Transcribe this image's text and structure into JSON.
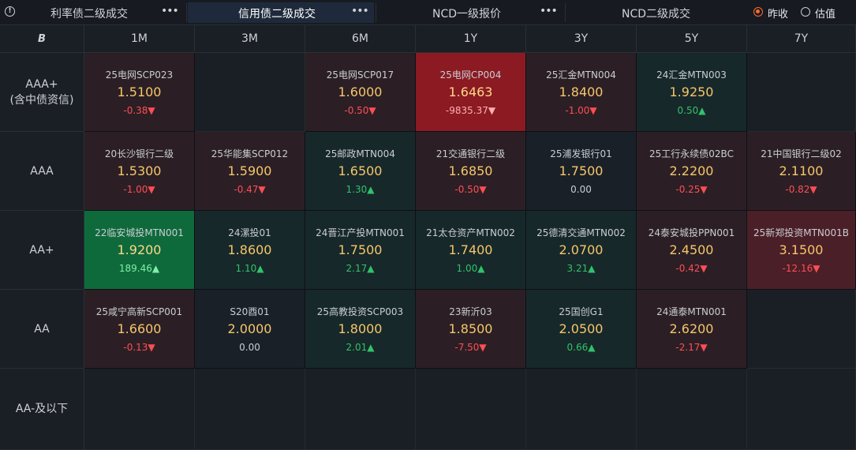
{
  "tabs": [
    {
      "label": "利率债二级成交",
      "more": "•••",
      "active": false
    },
    {
      "label": "信用债二级成交",
      "more": "•••",
      "active": true
    },
    {
      "label": "NCD一级报价",
      "more": "•••",
      "active": false
    },
    {
      "label": "NCD二级成交",
      "more": "",
      "active": false
    }
  ],
  "info_icon": "!",
  "price_mode": [
    {
      "label": "昨收",
      "selected": true
    },
    {
      "label": "估值",
      "selected": false
    }
  ],
  "corner_icon": "B",
  "columns": [
    "1M",
    "3M",
    "6M",
    "1Y",
    "3Y",
    "5Y",
    "7Y"
  ],
  "rows": [
    {
      "label": "AAA+\n(含中债资信)",
      "cells": [
        {
          "name": "25电网SCP023",
          "value": "1.5100",
          "change": "-0.38▼",
          "dir": "down",
          "bg": "bg-red"
        },
        null,
        {
          "name": "25电网SCP017",
          "value": "1.6000",
          "change": "-0.50▼",
          "dir": "down",
          "bg": "bg-red"
        },
        {
          "name": "25电网CP004",
          "value": "1.6463",
          "change": "-9835.37▼",
          "dir": "down",
          "bg": "bg-red-strong"
        },
        {
          "name": "25汇金MTN004",
          "value": "1.8400",
          "change": "-1.00▼",
          "dir": "down",
          "bg": "bg-red"
        },
        {
          "name": "24汇金MTN003",
          "value": "1.9250",
          "change": "0.50▲",
          "dir": "up",
          "bg": "bg-green"
        },
        null
      ]
    },
    {
      "label": "AAA",
      "cells": [
        {
          "name": "20长沙银行二级",
          "value": "1.5300",
          "change": "-1.00▼",
          "dir": "down",
          "bg": "bg-red"
        },
        {
          "name": "25华能集SCP012",
          "value": "1.5900",
          "change": "-0.47▼",
          "dir": "down",
          "bg": "bg-red"
        },
        {
          "name": "25邮政MTN004",
          "value": "1.6500",
          "change": "1.30▲",
          "dir": "up",
          "bg": "bg-green"
        },
        {
          "name": "21交通银行二级",
          "value": "1.6850",
          "change": "-0.50▼",
          "dir": "down",
          "bg": "bg-red"
        },
        {
          "name": "25浦发银行01",
          "value": "1.7500",
          "change": "0.00",
          "dir": "flat",
          "bg": "bg-neutral"
        },
        {
          "name": "25工行永续债02BC",
          "value": "2.2200",
          "change": "-0.25▼",
          "dir": "down",
          "bg": "bg-red"
        },
        {
          "name": "21中国银行二级02",
          "value": "2.1100",
          "change": "-0.82▼",
          "dir": "down",
          "bg": "bg-red"
        }
      ]
    },
    {
      "label": "AA+",
      "cells": [
        {
          "name": "22临安城投MTN001",
          "value": "1.9200",
          "change": "189.46▲",
          "dir": "up",
          "bg": "bg-green-strong"
        },
        {
          "name": "24漯投01",
          "value": "1.8600",
          "change": "1.10▲",
          "dir": "up",
          "bg": "bg-green"
        },
        {
          "name": "24晋江产投MTN001",
          "value": "1.7500",
          "change": "2.17▲",
          "dir": "up",
          "bg": "bg-green"
        },
        {
          "name": "21太仓资产MTN002",
          "value": "1.7400",
          "change": "1.00▲",
          "dir": "up",
          "bg": "bg-green"
        },
        {
          "name": "25德清交通MTN002",
          "value": "2.0700",
          "change": "3.21▲",
          "dir": "up",
          "bg": "bg-green"
        },
        {
          "name": "24泰安城投PPN001",
          "value": "2.4500",
          "change": "-0.42▼",
          "dir": "down",
          "bg": "bg-red"
        },
        {
          "name": "25新郑投资MTN001B",
          "value": "3.1500",
          "change": "-12.16▼",
          "dir": "down",
          "bg": "bg-red-mid"
        }
      ]
    },
    {
      "label": "AA",
      "cells": [
        {
          "name": "25咸宁高新SCP001",
          "value": "1.6600",
          "change": "-0.13▼",
          "dir": "down",
          "bg": "bg-red"
        },
        {
          "name": "S20酉01",
          "value": "2.0000",
          "change": "0.00",
          "dir": "flat",
          "bg": "bg-neutral"
        },
        {
          "name": "25高教投资SCP003",
          "value": "1.8000",
          "change": "2.01▲",
          "dir": "up",
          "bg": "bg-green"
        },
        {
          "name": "23新沂03",
          "value": "1.8500",
          "change": "-7.50▼",
          "dir": "down",
          "bg": "bg-red"
        },
        {
          "name": "25国创G1",
          "value": "2.0500",
          "change": "0.66▲",
          "dir": "up",
          "bg": "bg-green"
        },
        {
          "name": "24通泰MTN001",
          "value": "2.6200",
          "change": "-2.17▼",
          "dir": "down",
          "bg": "bg-red"
        },
        null
      ]
    },
    {
      "label": "AA-及以下",
      "cells": [
        null,
        null,
        null,
        null,
        null,
        null,
        null
      ]
    }
  ]
}
